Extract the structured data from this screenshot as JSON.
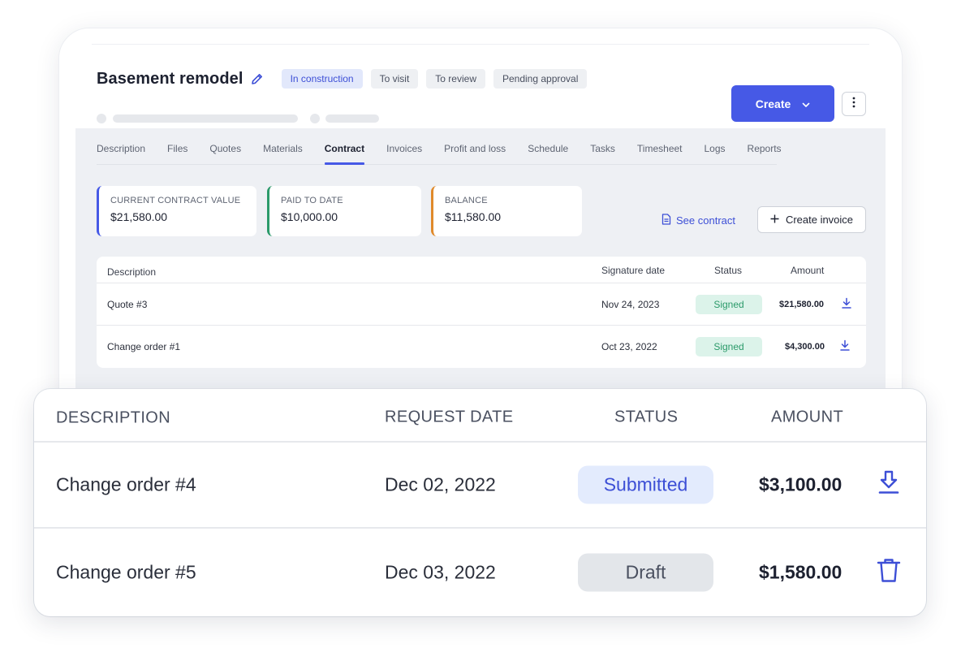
{
  "project": {
    "title": "Basement remodel",
    "tags": [
      "In construction",
      "To visit",
      "To review",
      "Pending approval"
    ],
    "create_label": "Create"
  },
  "tabs": [
    "Description",
    "Files",
    "Quotes",
    "Materials",
    "Contract",
    "Invoices",
    "Profit and loss",
    "Schedule",
    "Tasks",
    "Timesheet",
    "Logs",
    "Reports"
  ],
  "active_tab": "Contract",
  "stats": [
    {
      "label": "CURRENT CONTRACT VALUE",
      "value": "$21,580.00",
      "color": "#4659e6"
    },
    {
      "label": "PAID TO DATE",
      "value": "$10,000.00",
      "color": "#2b9a6a"
    },
    {
      "label": "BALANCE",
      "value": "$11,580.00",
      "color": "#e08a2b"
    }
  ],
  "actions": {
    "see_contract": "See contract",
    "create_invoice": "Create invoice"
  },
  "contract_table": {
    "headers": [
      "Description",
      "Signature date",
      "Status",
      "Amount"
    ],
    "rows": [
      {
        "description": "Quote #3",
        "date": "Nov 24, 2023",
        "status": "Signed",
        "amount": "$21,580.00"
      },
      {
        "description": "Change order #1",
        "date": "Oct 23, 2022",
        "status": "Signed",
        "amount": "$4,300.00"
      }
    ]
  },
  "change_orders": {
    "headers": [
      "DESCRIPTION",
      "REQUEST DATE",
      "STATUS",
      "AMOUNT"
    ],
    "rows": [
      {
        "description": "Change order #4",
        "date": "Dec 02, 2022",
        "status": "Submitted",
        "amount": "$3,100.00",
        "action_icon": "download-icon"
      },
      {
        "description": "Change order #5",
        "date": "Dec 03, 2022",
        "status": "Draft",
        "amount": "$1,580.00",
        "action_icon": "trash-icon"
      }
    ]
  },
  "colors": {
    "accent": "#4659e6",
    "signed": "#2b9a6a",
    "submitted": "#3d4fd6",
    "draft": "#4a5060"
  }
}
